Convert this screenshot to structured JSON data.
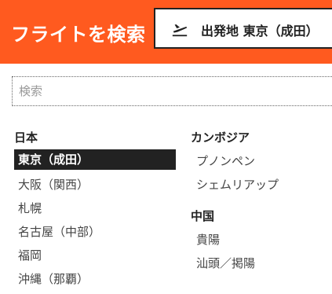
{
  "header": {
    "title": "フライトを検索",
    "origin_label": "出発地 東京（成田）",
    "origin_icon": "plane-departure-icon",
    "background": "#ff5a1f"
  },
  "search": {
    "placeholder": "検索",
    "value": ""
  },
  "regions": [
    {
      "name": "日本",
      "cities": [
        "東京（成田）",
        "大阪（関西）",
        "札幌",
        "名古屋（中部）",
        "福岡",
        "沖縄（那覇）"
      ],
      "selected_index": 0
    },
    {
      "name": "カンボジア",
      "cities": [
        "プノンペン",
        "シェムリアップ"
      ]
    },
    {
      "name": "中国",
      "cities": [
        "貴陽",
        "汕頭／掲陽"
      ]
    }
  ]
}
